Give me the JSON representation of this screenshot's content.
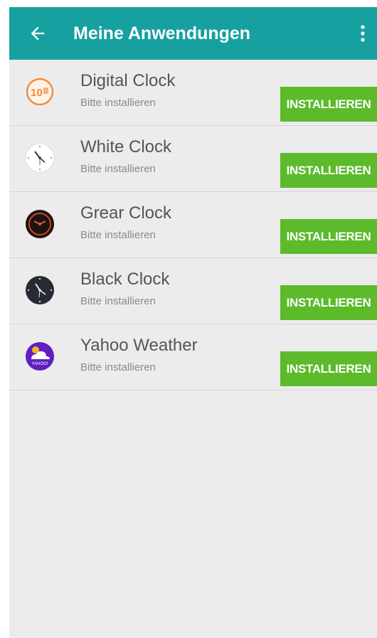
{
  "header": {
    "title": "Meine Anwendungen",
    "back_icon": "arrow-left-icon",
    "more_icon": "more-vertical-icon",
    "color": "#17a0a0"
  },
  "apps": [
    {
      "name": "Digital Clock",
      "status": "Bitte installieren",
      "action": "INSTALLIEREN",
      "icon": "digital-clock-icon",
      "icon_text": "10"
    },
    {
      "name": "White Clock",
      "status": "Bitte installieren",
      "action": "INSTALLIEREN",
      "icon": "white-clock-icon"
    },
    {
      "name": "Grear Clock",
      "status": "Bitte installieren",
      "action": "INSTALLIEREN",
      "icon": "gear-clock-icon"
    },
    {
      "name": "Black Clock",
      "status": "Bitte installieren",
      "action": "INSTALLIEREN",
      "icon": "black-clock-icon"
    },
    {
      "name": "Yahoo Weather",
      "status": "Bitte installieren",
      "action": "INSTALLIEREN",
      "icon": "yahoo-weather-icon",
      "icon_text": "YAHOO!"
    }
  ],
  "colors": {
    "button": "#5cba2b",
    "background": "#ececec"
  }
}
